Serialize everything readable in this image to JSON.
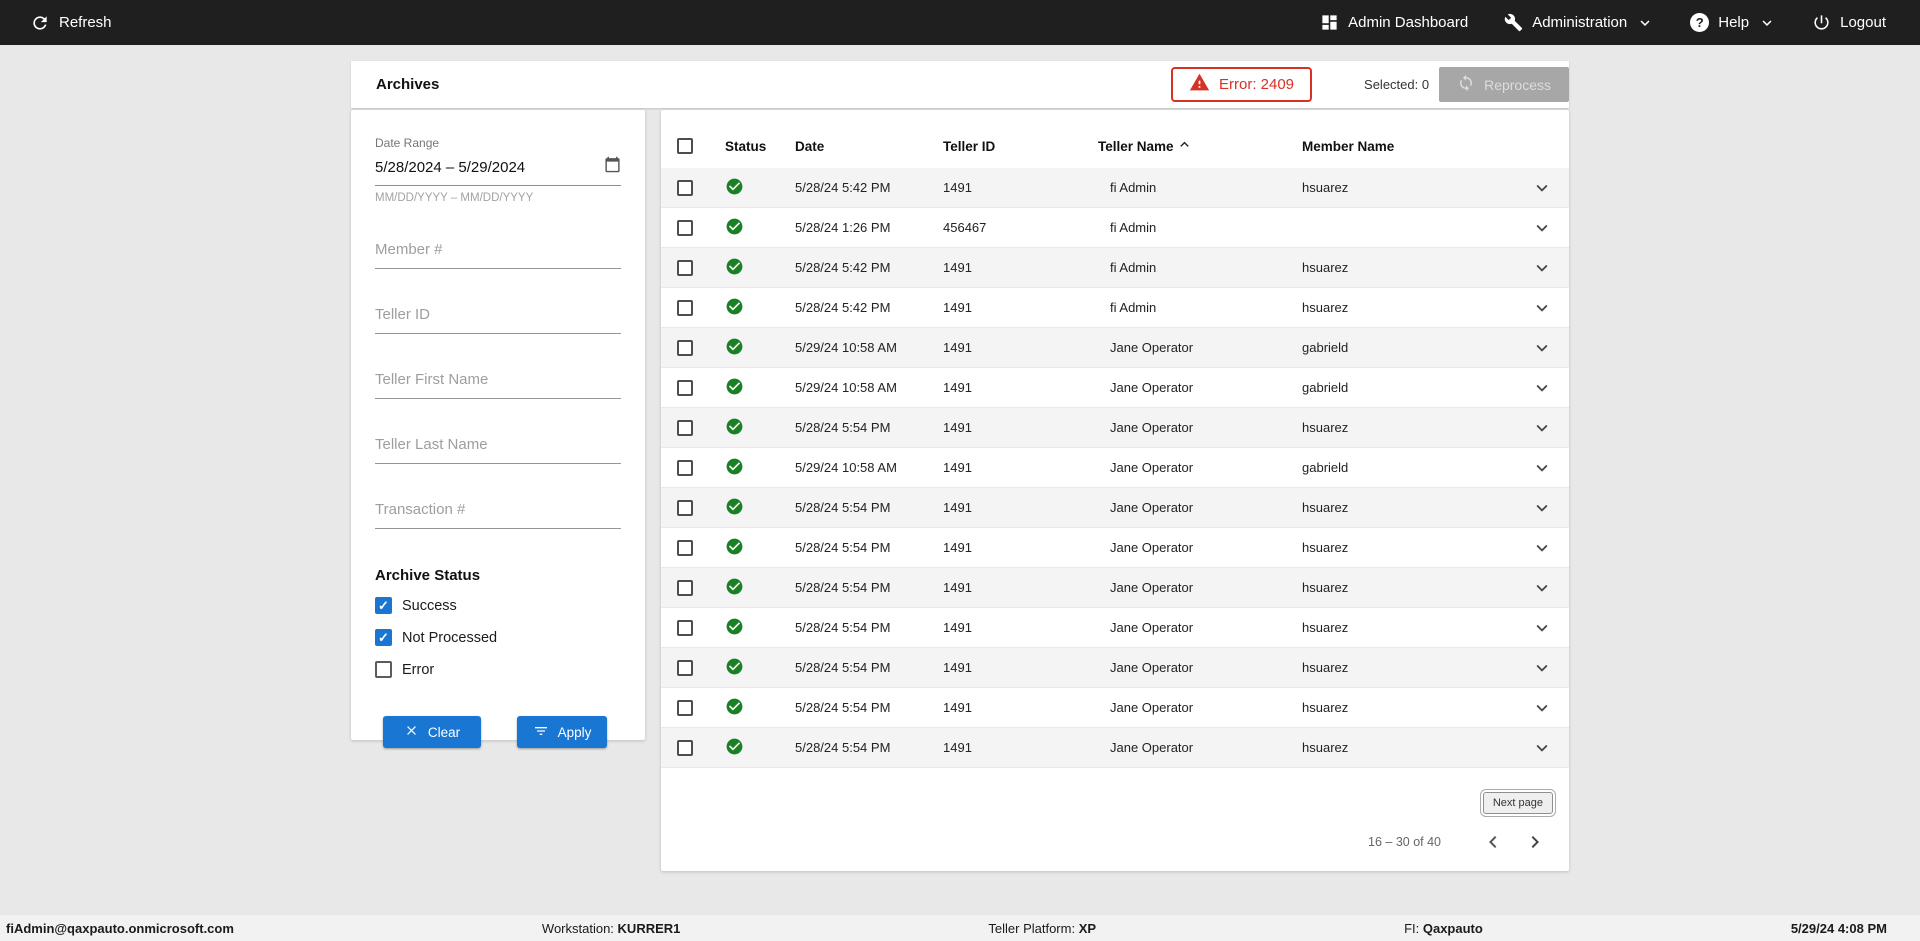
{
  "topbar": {
    "refresh": "Refresh",
    "admin_dashboard": "Admin Dashboard",
    "administration": "Administration",
    "help": "Help",
    "help_icon_glyph": "?",
    "logout": "Logout"
  },
  "header": {
    "title": "Archives",
    "error": "Error: 2409",
    "selected": "Selected: 0",
    "reprocess": "Reprocess"
  },
  "filters": {
    "date_range": {
      "label": "Date Range",
      "value": "5/28/2024 – 5/29/2024",
      "hint": "MM/DD/YYYY – MM/DD/YYYY"
    },
    "member_number": {
      "placeholder": "Member #",
      "value": ""
    },
    "teller_id": {
      "placeholder": "Teller ID",
      "value": ""
    },
    "teller_first_name": {
      "placeholder": "Teller First Name",
      "value": ""
    },
    "teller_last_name": {
      "placeholder": "Teller Last Name",
      "value": ""
    },
    "transaction_number": {
      "placeholder": "Transaction #",
      "value": ""
    },
    "archive_status": {
      "label": "Archive Status",
      "options": [
        {
          "label": "Success",
          "checked": true
        },
        {
          "label": "Not Processed",
          "checked": true
        },
        {
          "label": "Error",
          "checked": false
        }
      ]
    },
    "clear": "Clear",
    "apply": "Apply"
  },
  "table": {
    "columns": {
      "status": "Status",
      "date": "Date",
      "teller_id": "Teller ID",
      "teller_name": "Teller Name",
      "member_name": "Member Name"
    },
    "sorted_by": "Teller Name",
    "sort_direction": "asc",
    "rows": [
      {
        "status": "success",
        "date": "5/28/24 5:42 PM",
        "teller_id": "1491",
        "teller_name": "fi Admin",
        "member_name": "hsuarez"
      },
      {
        "status": "success",
        "date": "5/28/24 1:26 PM",
        "teller_id": "456467",
        "teller_name": "fi Admin",
        "member_name": ""
      },
      {
        "status": "success",
        "date": "5/28/24 5:42 PM",
        "teller_id": "1491",
        "teller_name": "fi Admin",
        "member_name": "hsuarez"
      },
      {
        "status": "success",
        "date": "5/28/24 5:42 PM",
        "teller_id": "1491",
        "teller_name": "fi Admin",
        "member_name": "hsuarez"
      },
      {
        "status": "success",
        "date": "5/29/24 10:58 AM",
        "teller_id": "1491",
        "teller_name": "Jane Operator",
        "member_name": "gabrield"
      },
      {
        "status": "success",
        "date": "5/29/24 10:58 AM",
        "teller_id": "1491",
        "teller_name": "Jane Operator",
        "member_name": "gabrield"
      },
      {
        "status": "success",
        "date": "5/28/24 5:54 PM",
        "teller_id": "1491",
        "teller_name": "Jane Operator",
        "member_name": "hsuarez"
      },
      {
        "status": "success",
        "date": "5/29/24 10:58 AM",
        "teller_id": "1491",
        "teller_name": "Jane Operator",
        "member_name": "gabrield"
      },
      {
        "status": "success",
        "date": "5/28/24 5:54 PM",
        "teller_id": "1491",
        "teller_name": "Jane Operator",
        "member_name": "hsuarez"
      },
      {
        "status": "success",
        "date": "5/28/24 5:54 PM",
        "teller_id": "1491",
        "teller_name": "Jane Operator",
        "member_name": "hsuarez"
      },
      {
        "status": "success",
        "date": "5/28/24 5:54 PM",
        "teller_id": "1491",
        "teller_name": "Jane Operator",
        "member_name": "hsuarez"
      },
      {
        "status": "success",
        "date": "5/28/24 5:54 PM",
        "teller_id": "1491",
        "teller_name": "Jane Operator",
        "member_name": "hsuarez"
      },
      {
        "status": "success",
        "date": "5/28/24 5:54 PM",
        "teller_id": "1491",
        "teller_name": "Jane Operator",
        "member_name": "hsuarez"
      },
      {
        "status": "success",
        "date": "5/28/24 5:54 PM",
        "teller_id": "1491",
        "teller_name": "Jane Operator",
        "member_name": "hsuarez"
      },
      {
        "status": "success",
        "date": "5/28/24 5:54 PM",
        "teller_id": "1491",
        "teller_name": "Jane Operator",
        "member_name": "hsuarez"
      }
    ]
  },
  "pagination": {
    "next_page": "Next page",
    "range": "16 – 30 of 40"
  },
  "statusbar": {
    "user": "fiAdmin@qaxpauto.onmicrosoft.com",
    "workstation_label": "Workstation:",
    "workstation": "KURRER1",
    "teller_platform_label": "Teller Platform:",
    "teller_platform": "XP",
    "fi_label": "FI:",
    "fi": "Qaxpauto",
    "datetime": "5/29/24 4:08 PM"
  },
  "colors": {
    "topbar_bg": "#1f1f1f",
    "accent_blue": "#1976d2",
    "success_green": "#1b8024",
    "error_red": "#d93025",
    "page_bg": "#e8e8e8"
  }
}
